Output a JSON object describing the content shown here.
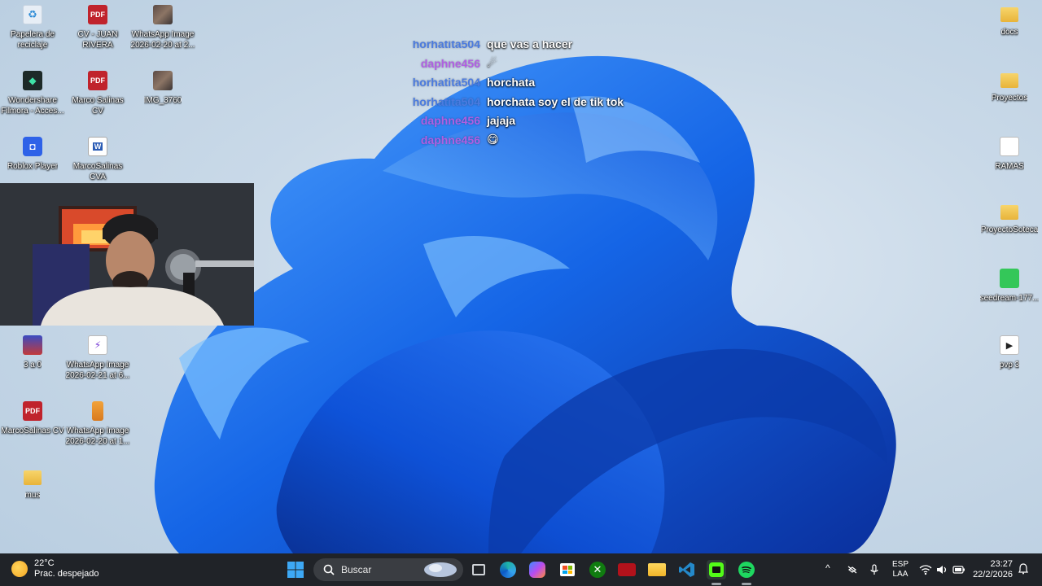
{
  "desktop": {
    "left_icons": [
      {
        "label": "Papelera de reciclaje",
        "icon": "recycle-bin-icon"
      },
      {
        "label": "CV - JUAN RIVERA",
        "icon": "pdf-icon"
      },
      {
        "label": "WhatsApp Image 2026-02-20 at 2...",
        "icon": "image-icon"
      },
      {
        "label": "Wondershare Filmora - Acces...",
        "icon": "filmora-icon"
      },
      {
        "label": "Marco Salinas CV",
        "icon": "pdf-icon"
      },
      {
        "label": "IMG_3760",
        "icon": "image-icon"
      },
      {
        "label": "Roblox Player",
        "icon": "roblox-icon"
      },
      {
        "label": "MarcoSalinas CVA",
        "icon": "word-icon"
      },
      {
        "label": "3 a 0",
        "icon": "game-icon"
      },
      {
        "label": "WhatsApp Image 2026-02-21 at 6...",
        "icon": "image-icon"
      },
      {
        "label": "MarcoSalinas CV",
        "icon": "pdf-icon"
      },
      {
        "label": "WhatsApp Image 2026-02-20 at 1...",
        "icon": "zip-icon"
      },
      {
        "label": "mus",
        "icon": "folder-icon"
      }
    ],
    "right_icons": [
      {
        "label": "docs",
        "icon": "folder-icon"
      },
      {
        "label": "Proyectos",
        "icon": "folder-icon"
      },
      {
        "label": "RAMAS",
        "icon": "document-icon"
      },
      {
        "label": "ProyectoSoteca",
        "icon": "folder-icon"
      },
      {
        "label": "seedream-177...",
        "icon": "image-icon"
      },
      {
        "label": "pvp 3",
        "icon": "video-icon"
      }
    ]
  },
  "chat": {
    "messages": [
      {
        "user": "horhatita504",
        "text": "que vas a hacer",
        "color": "#4b7be0"
      },
      {
        "user": "daphne456",
        "text": "☄",
        "color": "#b05fe3"
      },
      {
        "user": "horhatita504",
        "text": "horchata",
        "color": "#4b7be0"
      },
      {
        "user": "horhatita504",
        "text": "horchata soy el de tik tok",
        "color": "#4b7be0"
      },
      {
        "user": "daphne456",
        "text": "jajaja",
        "color": "#b05fe3"
      },
      {
        "user": "daphne456",
        "text": "😋",
        "color": "#b05fe3"
      }
    ]
  },
  "taskbar": {
    "weather": {
      "temp": "22°C",
      "condition": "Prac. despejado"
    },
    "search_placeholder": "Buscar",
    "apps": [
      "start-icon",
      "task-view-icon",
      "edge-icon",
      "copilot-icon",
      "store-icon",
      "xbox-icon",
      "red-app-icon",
      "file-explorer-icon",
      "vscode-icon",
      "streaming-app-icon",
      "spotify-icon"
    ],
    "tray": {
      "lang_top": "ESP",
      "lang_bottom": "LAA",
      "time": "23:27",
      "date": "22/2/2026"
    }
  }
}
